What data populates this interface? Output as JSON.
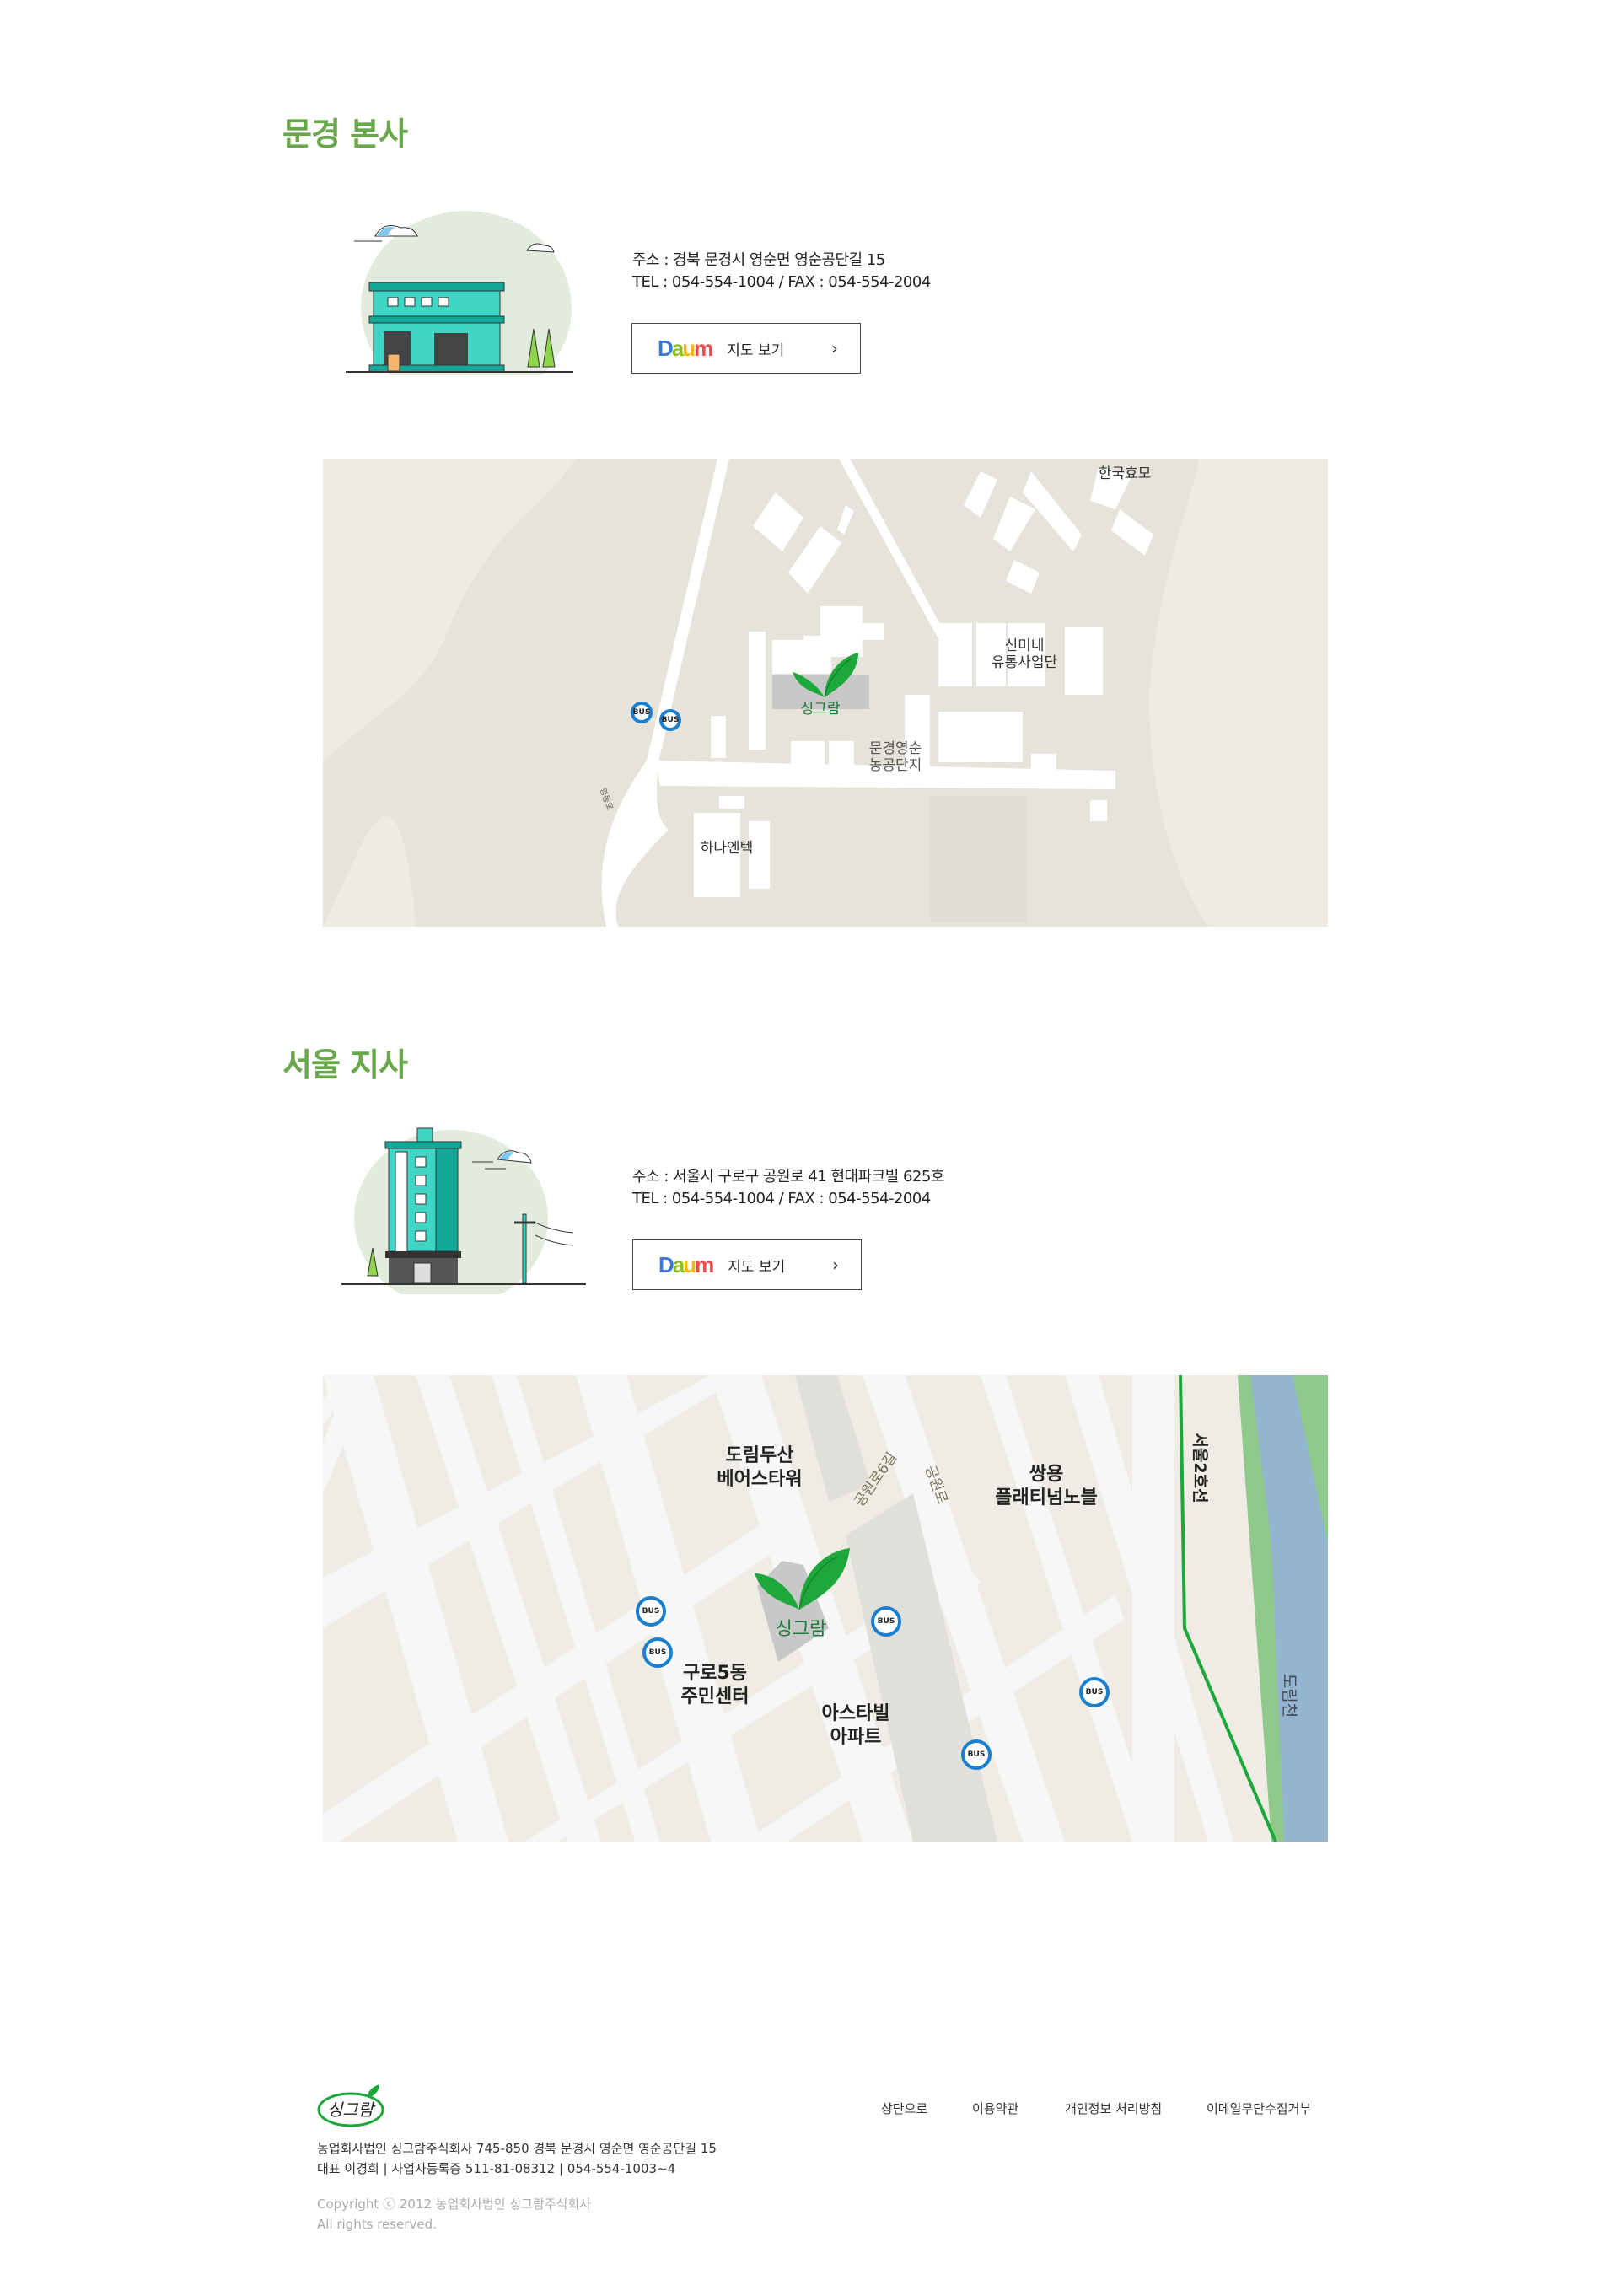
{
  "sections": [
    {
      "title": "문경 본사",
      "address": "주소 : 경북 문경시 영순면 영순공단길 15",
      "tel": "TEL : 054-554-1004 / FAX : 054-554-2004",
      "map_button": {
        "logo": "Daum",
        "label": "지도 보기",
        "icon": "chevron-right-icon"
      },
      "map": {
        "brand_label": "싱그람",
        "labels": [
          "한국효모",
          "신미네\n유통사업단",
          "문경영순\n농공단지",
          "하나엔텍",
          "영동로"
        ],
        "bus_label": "BUS"
      }
    },
    {
      "title": "서울 지사",
      "address": "주소 : 서울시 구로구 공원로 41 현대파크빌 625호",
      "tel": "TEL : 054-554-1004 / FAX : 054-554-2004",
      "map_button": {
        "logo": "Daum",
        "label": "지도 보기",
        "icon": "chevron-right-icon"
      },
      "map": {
        "brand_label": "싱그람",
        "labels": [
          "도림두산\n베어스타워",
          "공원로6길",
          "공원로",
          "쌍용\n플래티넘노블",
          "서울2호선",
          "도림천",
          "구로5동\n주민센터",
          "아스타빌\n아파트"
        ],
        "bus_label": "BUS"
      }
    }
  ],
  "footer": {
    "logo": "싱그람",
    "links": [
      "상단으로",
      "이용약관",
      "개인정보 처리방침",
      "이메일무단수집거부"
    ],
    "company": "농업회사법인 싱그람주식회사  745-850 경북 문경시 영순면 영순공단길 15",
    "reg": "대표  이경희  |  사업자등록증  511-81-08312  |  054-554-1003~4",
    "copyright": "Copyright ⓒ 2012 농업회사법인 싱그람주식회사",
    "rights": "All rights reserved."
  },
  "colors": {
    "accent": "#69a84a",
    "bus": "#1a7fcf",
    "leaf": "#1ea83c",
    "river": "#93b5cf",
    "subway": "#1ea83c"
  }
}
